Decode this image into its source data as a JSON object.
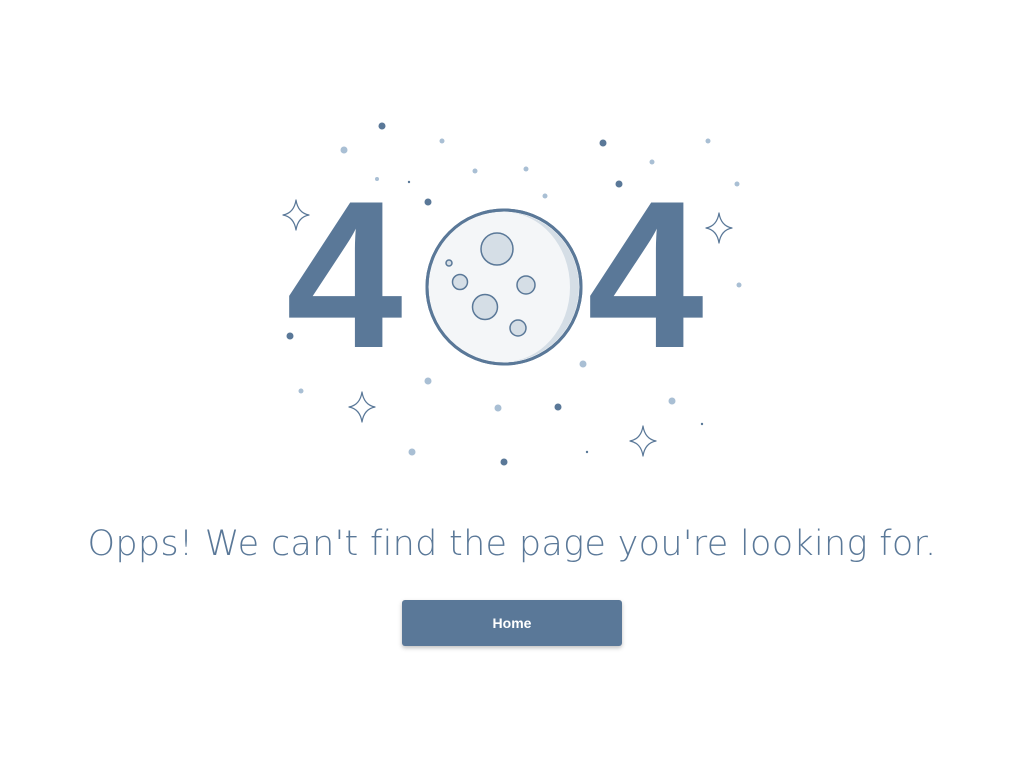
{
  "error": {
    "code_left": "4",
    "code_right": "4",
    "message": "Opps! We can't find the page you're looking for."
  },
  "actions": {
    "home_label": "Home"
  },
  "illustration": {
    "moon_icon": "moon-icon",
    "star_icon": "sparkle-star-icon",
    "dot_icon": "star-dot-icon"
  },
  "colors": {
    "primary": "#5a7898",
    "light_dot": "#a9bfd4",
    "moon_fill": "#f4f6f8",
    "moon_shadow": "#d5dee6",
    "button_text": "#ffffff"
  }
}
